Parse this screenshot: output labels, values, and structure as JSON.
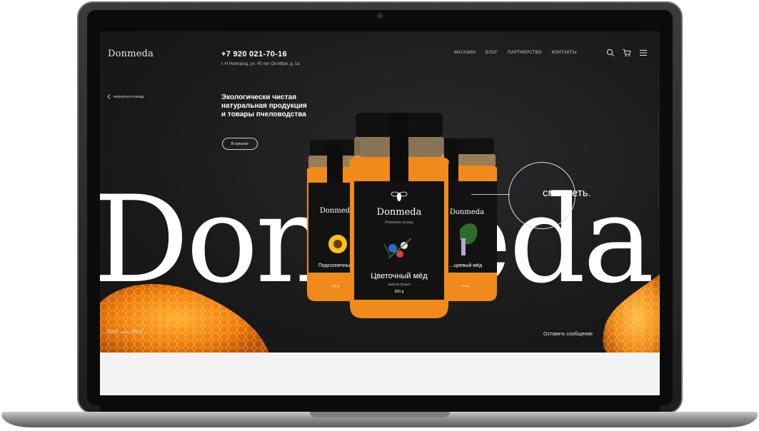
{
  "header": {
    "logo": "Donmeda",
    "phone": "+7 920 021-70-16",
    "address": "г. Н.Новгород, ул. 40 лет Октября, д. 1а",
    "nav": [
      "МАГАЗИН",
      "БЛОГ",
      "ПАРТНЕРСТВО",
      "КОНТАКТЫ"
    ]
  },
  "hero": {
    "back_link": "вернуться назад",
    "headline": [
      "Экологически чистая",
      "натуральная продукция",
      "и товары пчеловодства"
    ],
    "catalog_button": "В каталог",
    "brand_big": "Donmeda",
    "look_text": "смотреть",
    "look_dot": ".",
    "counter_start": "0001",
    "counter_end": "0003",
    "message_link": "Оставить сообщение"
  },
  "jars": {
    "center": {
      "brand": "Donmeda",
      "sub": "Premium honey",
      "name": "Цветочный мёд",
      "type": "natural flower",
      "weight": "900 g"
    },
    "left": {
      "brand": "Donmeda",
      "name": "Подсолнечный",
      "weight": "900 g"
    },
    "right": {
      "brand": "Donmeda",
      "name": "…циевый мёд",
      "weight": "900 g"
    }
  },
  "colors": {
    "accent": "#f3a21b",
    "honey": "#f08a1a",
    "background": "#1b1b1c"
  },
  "icons": [
    "search-icon",
    "cart-icon",
    "menu-icon",
    "chevron-left-icon"
  ]
}
